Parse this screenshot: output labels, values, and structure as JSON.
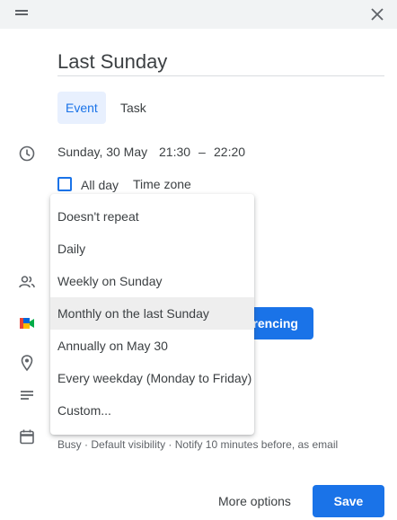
{
  "event": {
    "title": "Last Sunday",
    "tabs": [
      {
        "label": "Event",
        "selected": true
      },
      {
        "label": "Task",
        "selected": false
      }
    ],
    "date": "Sunday, 30 May",
    "start_time": "21:30",
    "dash": "–",
    "end_time": "22:20",
    "all_day_label": "All day",
    "time_zone_label": "Time zone",
    "conference_button_partial": "rencing",
    "status": {
      "busy": "Busy",
      "visibility": "Default visibility",
      "notify": "Notify 10 minutes before, as email",
      "separator": "·"
    }
  },
  "repeat_menu": {
    "items": [
      "Doesn't repeat",
      "Daily",
      "Weekly on Sunday",
      "Monthly on the last Sunday",
      "Annually on May 30",
      "Every weekday (Monday to Friday)",
      "Custom..."
    ],
    "highlighted_index": 3
  },
  "footer": {
    "more_options": "More options",
    "save": "Save"
  },
  "colors": {
    "accent": "#1a73e8",
    "tab_bg": "#e8f0fe",
    "highlight": "#eeeeee",
    "topbar": "#f1f3f4"
  },
  "icons": [
    "drag-handle-icon",
    "close-icon",
    "clock-icon",
    "people-icon",
    "meet-icon",
    "location-icon",
    "description-icon",
    "calendar-icon"
  ]
}
